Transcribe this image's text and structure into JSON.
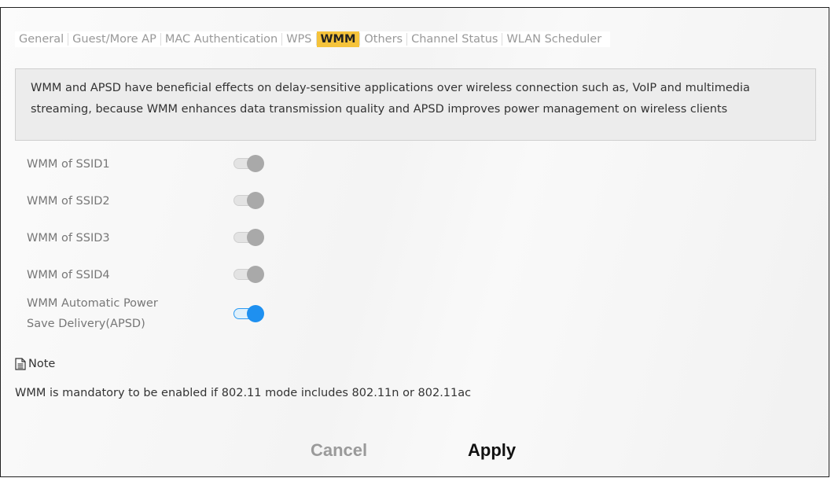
{
  "tabs": [
    {
      "label": "General"
    },
    {
      "label": "Guest/More AP"
    },
    {
      "label": "MAC Authentication"
    },
    {
      "label": "WPS"
    },
    {
      "label": "WMM",
      "active": true
    },
    {
      "label": "Others"
    },
    {
      "label": "Channel Status"
    },
    {
      "label": "WLAN Scheduler"
    }
  ],
  "description": "WMM and APSD have beneficial effects on delay-sensitive applications over wireless connection such as, VoIP and multimedia streaming, because WMM enhances data transmission quality and APSD improves power management on wireless clients",
  "settings": [
    {
      "label": "WMM of SSID1",
      "enabled": false
    },
    {
      "label": "WMM of SSID2",
      "enabled": false
    },
    {
      "label": "WMM of SSID3",
      "enabled": false
    },
    {
      "label": "WMM of SSID4",
      "enabled": false
    },
    {
      "label_line1": "WMM Automatic Power",
      "label_line2": "Save Delivery(APSD)",
      "enabled": true
    }
  ],
  "note": {
    "icon": "note-icon",
    "title": "Note",
    "text": "WMM is mandatory to be enabled if 802.11 mode includes 802.11n or 802.11ac"
  },
  "buttons": {
    "cancel_label": "Cancel",
    "apply_label": "Apply"
  },
  "colors": {
    "accent": "#f5c33b",
    "toggle_on": "#1e90f0",
    "toggle_off": "#a9a9a9"
  }
}
